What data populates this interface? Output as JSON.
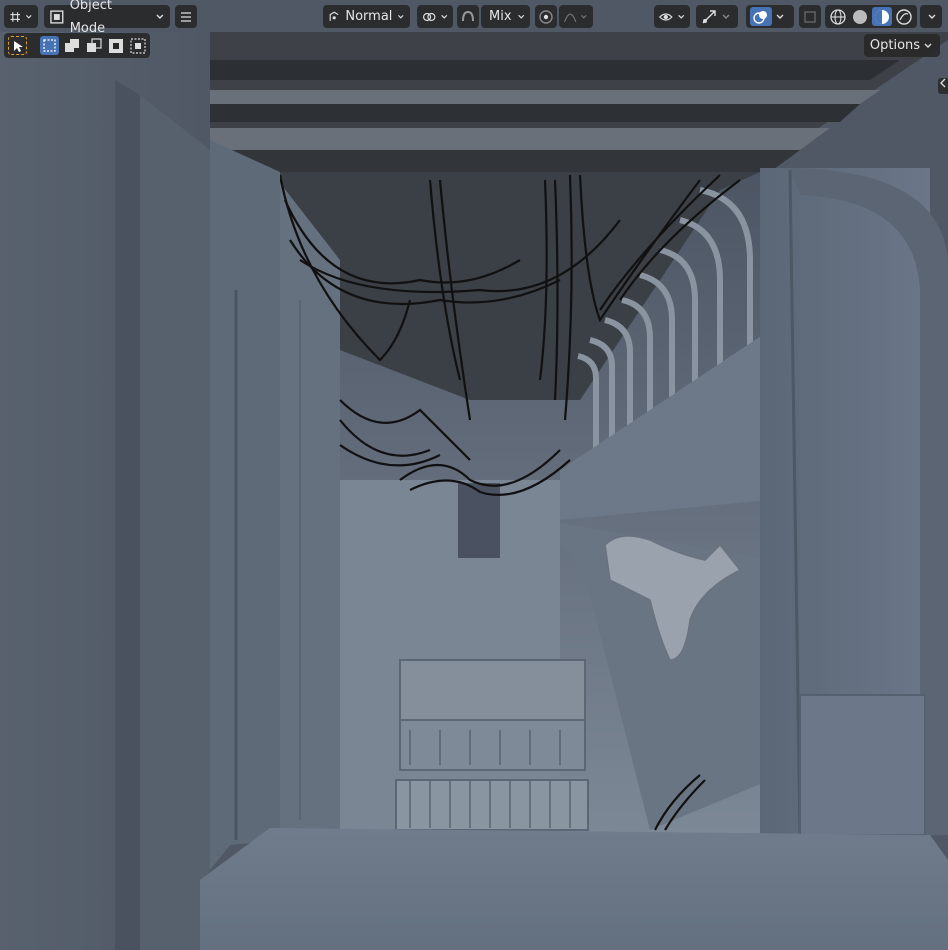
{
  "header": {
    "editor_type_icon": "viewport-grid-icon",
    "mode_label": "Object Mode",
    "menu_icon": "hamburger-menu-icon",
    "orientation_label": "Normal",
    "pivot_icon": "transform-pivot-icon",
    "snap_icon": "snap-magnet-icon",
    "proportional_label": "Mix",
    "proportional_icon": "proportional-editing-icon",
    "falloff_icon": "falloff-curve-icon",
    "visibility_icon": "eye-visibility-icon",
    "gizmo_icon": "gizmo-icon",
    "overlay_icon": "overlay-icon",
    "xray_icon": "xray-icon",
    "shading": [
      "wireframe",
      "solid",
      "material-preview",
      "rendered"
    ],
    "active_shading": "material-preview"
  },
  "toolrow": {
    "select_tool_icon": "select-cursor-icon",
    "modes": [
      "new-selection",
      "extend-selection",
      "subtract-selection",
      "invert-selection",
      "intersect-selection"
    ]
  },
  "options_label": "Options",
  "colors": {
    "accent": "#4772b3",
    "ui_bg": "#282828",
    "wall": "#5d6878",
    "floor": "#6b7788",
    "ceiling": "#3a3d42"
  }
}
